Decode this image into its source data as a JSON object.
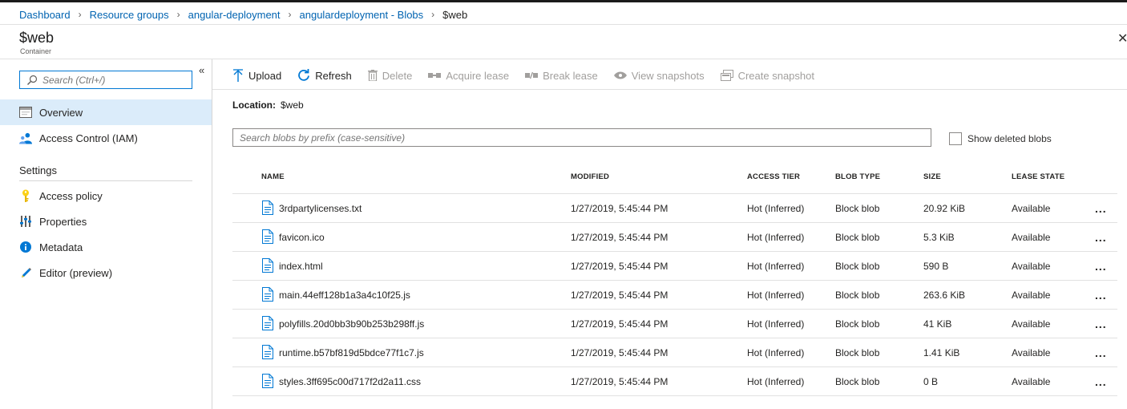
{
  "breadcrumb": {
    "items": [
      "Dashboard",
      "Resource groups",
      "angular-deployment",
      "angulardeployment - Blobs"
    ],
    "current": "$web"
  },
  "blade": {
    "title": "$web",
    "subtitle": "Container",
    "close_glyph": "✕"
  },
  "nav": {
    "search_placeholder": "Search (Ctrl+/)",
    "collapse_glyph": "«",
    "items_top": [
      {
        "label": "Overview",
        "icon": "overview-icon",
        "active": true
      },
      {
        "label": "Access Control (IAM)",
        "icon": "iam-icon",
        "active": false
      }
    ],
    "section": "Settings",
    "items_settings": [
      {
        "label": "Access policy",
        "icon": "key-icon"
      },
      {
        "label": "Properties",
        "icon": "properties-icon"
      },
      {
        "label": "Metadata",
        "icon": "info-icon"
      },
      {
        "label": "Editor (preview)",
        "icon": "pencil-icon"
      }
    ]
  },
  "toolbar": {
    "upload": "Upload",
    "refresh": "Refresh",
    "delete": "Delete",
    "acquire_lease": "Acquire lease",
    "break_lease": "Break lease",
    "view_snapshots": "View snapshots",
    "create_snapshot": "Create snapshot"
  },
  "location": {
    "label": "Location:",
    "value": "$web"
  },
  "blob_search": {
    "placeholder": "Search blobs by prefix (case-sensitive)"
  },
  "show_deleted": {
    "label": "Show deleted blobs",
    "checked": false
  },
  "table": {
    "columns": {
      "name": "NAME",
      "modified": "MODIFIED",
      "access_tier": "ACCESS TIER",
      "blob_type": "BLOB TYPE",
      "size": "SIZE",
      "lease_state": "LEASE STATE"
    },
    "rows": [
      {
        "name": "3rdpartylicenses.txt",
        "modified": "1/27/2019, 5:45:44 PM",
        "access_tier": "Hot (Inferred)",
        "blob_type": "Block blob",
        "size": "20.92 KiB",
        "lease_state": "Available"
      },
      {
        "name": "favicon.ico",
        "modified": "1/27/2019, 5:45:44 PM",
        "access_tier": "Hot (Inferred)",
        "blob_type": "Block blob",
        "size": "5.3 KiB",
        "lease_state": "Available"
      },
      {
        "name": "index.html",
        "modified": "1/27/2019, 5:45:44 PM",
        "access_tier": "Hot (Inferred)",
        "blob_type": "Block blob",
        "size": "590 B",
        "lease_state": "Available"
      },
      {
        "name": "main.44eff128b1a3a4c10f25.js",
        "modified": "1/27/2019, 5:45:44 PM",
        "access_tier": "Hot (Inferred)",
        "blob_type": "Block blob",
        "size": "263.6 KiB",
        "lease_state": "Available"
      },
      {
        "name": "polyfills.20d0bb3b90b253b298ff.js",
        "modified": "1/27/2019, 5:45:44 PM",
        "access_tier": "Hot (Inferred)",
        "blob_type": "Block blob",
        "size": "41 KiB",
        "lease_state": "Available"
      },
      {
        "name": "runtime.b57bf819d5bdce77f1c7.js",
        "modified": "1/27/2019, 5:45:44 PM",
        "access_tier": "Hot (Inferred)",
        "blob_type": "Block blob",
        "size": "1.41 KiB",
        "lease_state": "Available"
      },
      {
        "name": "styles.3ff695c00d717f2d2a11.css",
        "modified": "1/27/2019, 5:45:44 PM",
        "access_tier": "Hot (Inferred)",
        "blob_type": "Block blob",
        "size": "0 B",
        "lease_state": "Available"
      }
    ],
    "row_menu_glyph": "..."
  },
  "colors": {
    "accent": "#0078d4",
    "link": "#0063b1",
    "active_nav": "#dbecfa",
    "disabled_text": "#a19f9d"
  }
}
